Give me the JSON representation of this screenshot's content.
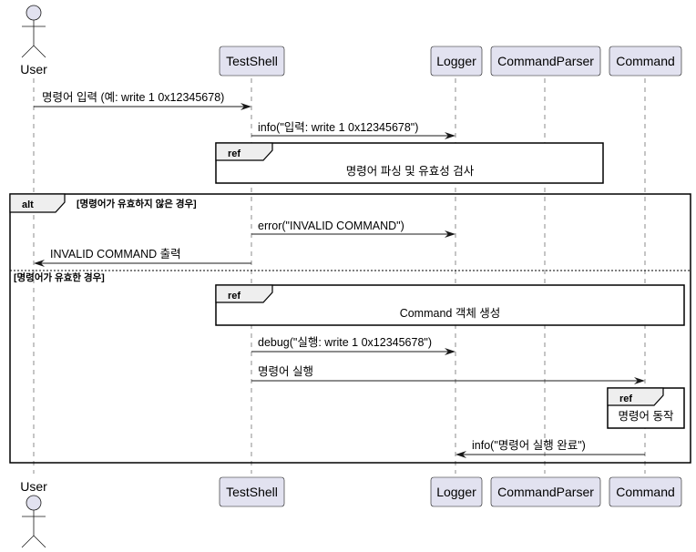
{
  "diagram": {
    "type": "sequence",
    "participants": [
      {
        "id": "user",
        "label": "User",
        "kind": "actor"
      },
      {
        "id": "testshell",
        "label": "TestShell",
        "kind": "participant"
      },
      {
        "id": "logger",
        "label": "Logger",
        "kind": "participant"
      },
      {
        "id": "parser",
        "label": "CommandParser",
        "kind": "participant"
      },
      {
        "id": "command",
        "label": "Command",
        "kind": "participant"
      }
    ],
    "messages": [
      {
        "from": "user",
        "to": "testshell",
        "label": "명령어 입력 (예: write 1 0x12345678)"
      },
      {
        "from": "testshell",
        "to": "logger",
        "label": "info(\"입력: write 1 0x12345678\")"
      },
      {
        "from": "testshell",
        "to": "logger",
        "label": "error(\"INVALID COMMAND\")"
      },
      {
        "from": "testshell",
        "to": "user",
        "label": "INVALID COMMAND 출력"
      },
      {
        "from": "testshell",
        "to": "logger",
        "label": "debug(\"실행: write 1 0x12345678\")"
      },
      {
        "from": "testshell",
        "to": "command",
        "label": "명령어 실행"
      },
      {
        "from": "command",
        "to": "logger",
        "label": "info(\"명령어 실행 완료\")"
      }
    ],
    "refs": [
      {
        "tag": "ref",
        "text": "명령어 파싱 및 유효성 검사"
      },
      {
        "tag": "ref",
        "text": "Command 객체 생성"
      },
      {
        "tag": "ref",
        "text": "명령어 동작"
      }
    ],
    "alt": {
      "tag": "alt",
      "guard1": "[명령어가 유효하지 않은 경우]",
      "guard2": "[명령어가 유효한 경우]"
    }
  },
  "colors": {
    "participant_fill": "#e2e2f0",
    "participant_stroke": "#181818",
    "lifeline": "#181818",
    "frame_tag_fill": "#eeeeee"
  }
}
